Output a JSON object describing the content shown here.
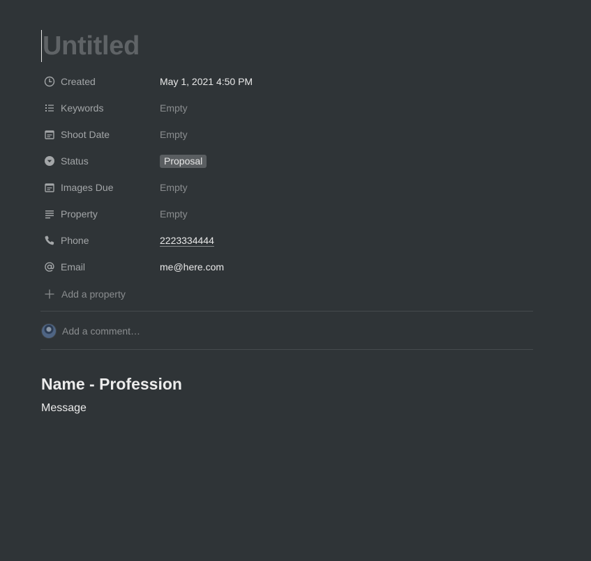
{
  "page": {
    "title_placeholder": "Untitled"
  },
  "properties": [
    {
      "name": "Created",
      "icon": "clock-icon",
      "value": "May 1, 2021 4:50 PM",
      "kind": "text"
    },
    {
      "name": "Keywords",
      "icon": "list-icon",
      "value": "Empty",
      "kind": "empty"
    },
    {
      "name": "Shoot Date",
      "icon": "calendar-icon",
      "value": "Empty",
      "kind": "empty"
    },
    {
      "name": "Status",
      "icon": "select-icon",
      "value": "Proposal",
      "kind": "tag"
    },
    {
      "name": "Images Due",
      "icon": "calendar-icon",
      "value": "Empty",
      "kind": "empty"
    },
    {
      "name": "Property",
      "icon": "text-lines-icon",
      "value": "Empty",
      "kind": "empty"
    },
    {
      "name": "Phone",
      "icon": "phone-icon",
      "value": "2223334444",
      "kind": "link"
    },
    {
      "name": "Email",
      "icon": "at-sign-icon",
      "value": "me@here.com",
      "kind": "text"
    }
  ],
  "add_property_label": "Add a property",
  "comment": {
    "placeholder": "Add a comment…"
  },
  "content": {
    "heading": "Name - Profession",
    "body": "Message"
  },
  "colors": {
    "background": "#2f3437",
    "tag_background": "#5a5e61"
  }
}
